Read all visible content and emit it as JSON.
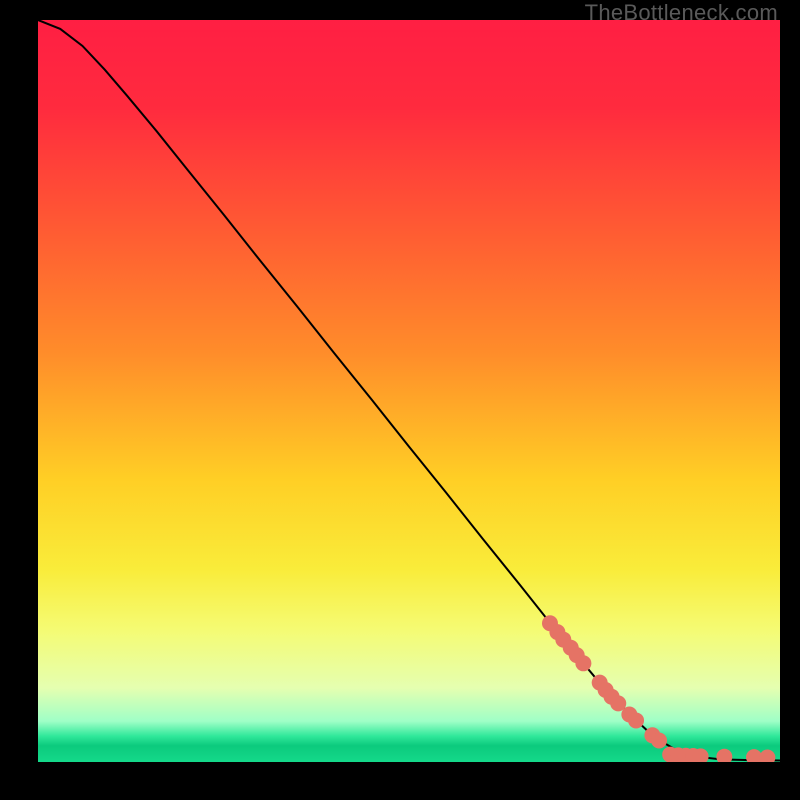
{
  "watermark": "TheBottleneck.com",
  "chart_data": {
    "type": "line",
    "title": "",
    "xlabel": "",
    "ylabel": "",
    "xlim": [
      0,
      100
    ],
    "ylim": [
      0,
      100
    ],
    "grid": false,
    "legend": false,
    "background_gradient_stops": [
      {
        "offset": 0.0,
        "color": "#ff1f43"
      },
      {
        "offset": 0.12,
        "color": "#ff2b3e"
      },
      {
        "offset": 0.28,
        "color": "#ff5a33"
      },
      {
        "offset": 0.45,
        "color": "#ff8d2a"
      },
      {
        "offset": 0.62,
        "color": "#ffcf25"
      },
      {
        "offset": 0.74,
        "color": "#f9ec3a"
      },
      {
        "offset": 0.82,
        "color": "#f5fb72"
      },
      {
        "offset": 0.9,
        "color": "#e5ffb0"
      },
      {
        "offset": 0.945,
        "color": "#9fffc7"
      },
      {
        "offset": 0.965,
        "color": "#30e89a"
      },
      {
        "offset": 0.978,
        "color": "#0cca7d"
      },
      {
        "offset": 1.0,
        "color": "#14d98a"
      }
    ],
    "series": [
      {
        "name": "curve",
        "stroke": "#000000",
        "points": [
          {
            "x": 0.0,
            "y": 100.0
          },
          {
            "x": 3.0,
            "y": 98.8
          },
          {
            "x": 6.0,
            "y": 96.5
          },
          {
            "x": 9.0,
            "y": 93.3
          },
          {
            "x": 12.0,
            "y": 89.8
          },
          {
            "x": 16.0,
            "y": 85.0
          },
          {
            "x": 20.0,
            "y": 80.0
          },
          {
            "x": 25.0,
            "y": 73.8
          },
          {
            "x": 30.0,
            "y": 67.5
          },
          {
            "x": 35.0,
            "y": 61.3
          },
          {
            "x": 40.0,
            "y": 55.0
          },
          {
            "x": 45.0,
            "y": 48.8
          },
          {
            "x": 50.0,
            "y": 42.5
          },
          {
            "x": 55.0,
            "y": 36.3
          },
          {
            "x": 60.0,
            "y": 30.0
          },
          {
            "x": 65.0,
            "y": 23.8
          },
          {
            "x": 70.0,
            "y": 17.5
          },
          {
            "x": 75.0,
            "y": 11.5
          },
          {
            "x": 80.0,
            "y": 6.2
          },
          {
            "x": 83.0,
            "y": 3.4
          },
          {
            "x": 86.0,
            "y": 1.6
          },
          {
            "x": 89.0,
            "y": 0.7
          },
          {
            "x": 92.0,
            "y": 0.35
          },
          {
            "x": 96.0,
            "y": 0.25
          },
          {
            "x": 100.0,
            "y": 0.2
          }
        ]
      }
    ],
    "scatter": {
      "name": "markers",
      "color": "#e57365",
      "radius_px": 8,
      "points": [
        {
          "x": 69.0,
          "y": 18.7
        },
        {
          "x": 70.0,
          "y": 17.5
        },
        {
          "x": 70.8,
          "y": 16.5
        },
        {
          "x": 71.8,
          "y": 15.4
        },
        {
          "x": 72.6,
          "y": 14.4
        },
        {
          "x": 73.5,
          "y": 13.3
        },
        {
          "x": 75.7,
          "y": 10.7
        },
        {
          "x": 76.5,
          "y": 9.7
        },
        {
          "x": 77.3,
          "y": 8.8
        },
        {
          "x": 78.2,
          "y": 7.9
        },
        {
          "x": 79.7,
          "y": 6.4
        },
        {
          "x": 80.6,
          "y": 5.6
        },
        {
          "x": 82.8,
          "y": 3.6
        },
        {
          "x": 83.7,
          "y": 2.9
        },
        {
          "x": 85.2,
          "y": 1.0
        },
        {
          "x": 86.3,
          "y": 0.9
        },
        {
          "x": 87.3,
          "y": 0.85
        },
        {
          "x": 88.3,
          "y": 0.8
        },
        {
          "x": 89.3,
          "y": 0.75
        },
        {
          "x": 92.5,
          "y": 0.7
        },
        {
          "x": 96.5,
          "y": 0.65
        },
        {
          "x": 98.3,
          "y": 0.6
        }
      ]
    }
  }
}
